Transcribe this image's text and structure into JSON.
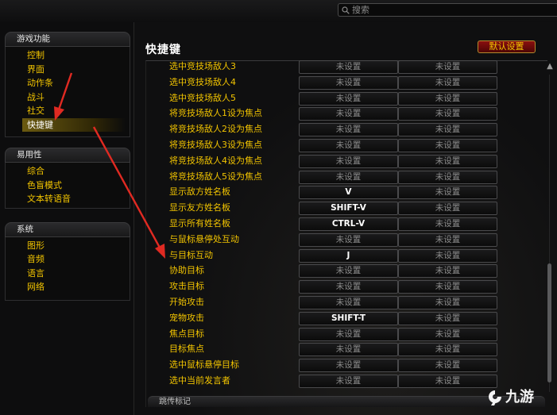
{
  "search": {
    "placeholder": "搜索"
  },
  "sidebar": {
    "categories": [
      {
        "label": "游戏功能",
        "items": [
          {
            "label": "控制"
          },
          {
            "label": "界面"
          },
          {
            "label": "动作条"
          },
          {
            "label": "战斗"
          },
          {
            "label": "社交"
          },
          {
            "label": "快捷键"
          }
        ]
      },
      {
        "label": "易用性",
        "items": [
          {
            "label": "综合"
          },
          {
            "label": "色盲模式"
          },
          {
            "label": "文本转语音"
          }
        ]
      },
      {
        "label": "系统",
        "items": [
          {
            "label": "图形"
          },
          {
            "label": "音频"
          },
          {
            "label": "语言"
          },
          {
            "label": "网络"
          }
        ]
      }
    ],
    "active_item": "快捷键"
  },
  "main": {
    "title": "快捷键",
    "defaults_button": "默认设置",
    "next_section_label": "跳传标记",
    "bindings": [
      {
        "action": "选中竞技场敌人3",
        "key1": "未设置",
        "key2": "未设置"
      },
      {
        "action": "选中竞技场敌人4",
        "key1": "未设置",
        "key2": "未设置"
      },
      {
        "action": "选中竞技场敌人5",
        "key1": "未设置",
        "key2": "未设置"
      },
      {
        "action": "将竞技场敌人1设为焦点",
        "key1": "未设置",
        "key2": "未设置"
      },
      {
        "action": "将竞技场敌人2设为焦点",
        "key1": "未设置",
        "key2": "未设置"
      },
      {
        "action": "将竞技场敌人3设为焦点",
        "key1": "未设置",
        "key2": "未设置"
      },
      {
        "action": "将竞技场敌人4设为焦点",
        "key1": "未设置",
        "key2": "未设置"
      },
      {
        "action": "将竞技场敌人5设为焦点",
        "key1": "未设置",
        "key2": "未设置"
      },
      {
        "action": "显示敌方姓名板",
        "key1": "V",
        "key2": "未设置"
      },
      {
        "action": "显示友方姓名板",
        "key1": "SHIFT-V",
        "key2": "未设置"
      },
      {
        "action": "显示所有姓名板",
        "key1": "CTRL-V",
        "key2": "未设置"
      },
      {
        "action": "与鼠标悬停处互动",
        "key1": "未设置",
        "key2": "未设置"
      },
      {
        "action": "与目标互动",
        "key1": "J",
        "key2": "未设置"
      },
      {
        "action": "协助目标",
        "key1": "未设置",
        "key2": "未设置"
      },
      {
        "action": "攻击目标",
        "key1": "未设置",
        "key2": "未设置"
      },
      {
        "action": "开始攻击",
        "key1": "未设置",
        "key2": "未设置"
      },
      {
        "action": "宠物攻击",
        "key1": "SHIFT-T",
        "key2": "未设置"
      },
      {
        "action": "焦点目标",
        "key1": "未设置",
        "key2": "未设置"
      },
      {
        "action": "目标焦点",
        "key1": "未设置",
        "key2": "未设置"
      },
      {
        "action": "选中鼠标悬停目标",
        "key1": "未设置",
        "key2": "未设置"
      },
      {
        "action": "选中当前发言者",
        "key1": "未设置",
        "key2": "未设置"
      }
    ]
  },
  "watermark": {
    "text": "九游"
  },
  "colors": {
    "accent_gold": "#f2c400",
    "annotation_red": "#e02a22",
    "defaults_red": "#7a0a0a"
  }
}
